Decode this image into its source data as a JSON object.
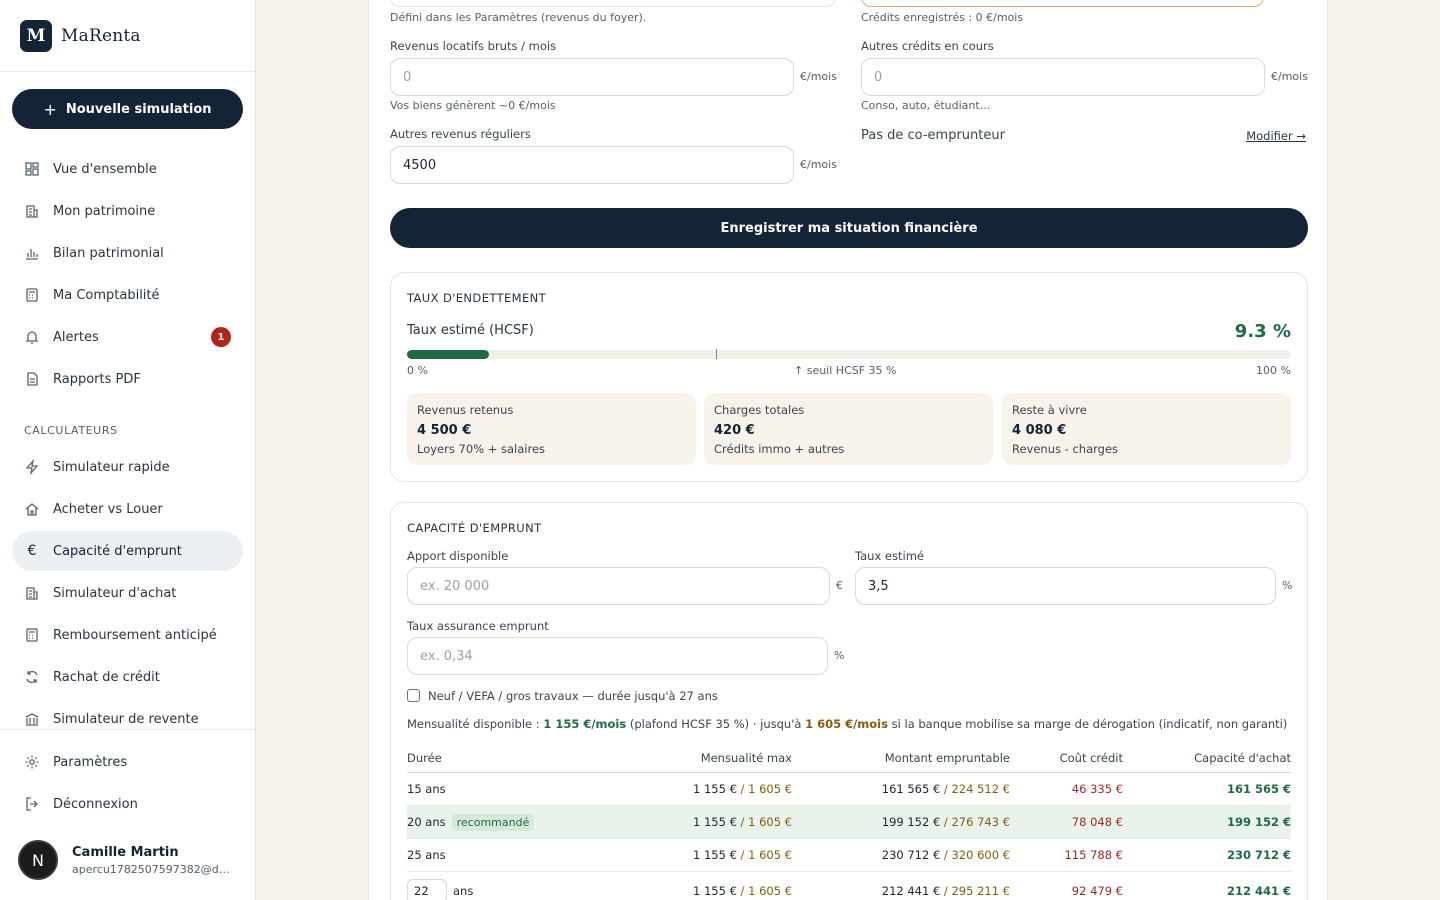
{
  "brand": {
    "logo_letter": "M",
    "name": "MaRenta"
  },
  "sidebar": {
    "new_simulation": "Nouvelle simulation",
    "main_items": [
      {
        "label": "Vue d'ensemble",
        "icon": "dashboard-icon"
      },
      {
        "label": "Mon patrimoine",
        "icon": "building-icon"
      },
      {
        "label": "Bilan patrimonial",
        "icon": "bar-chart-icon"
      },
      {
        "label": "Ma Comptabilité",
        "icon": "calculator-icon"
      },
      {
        "label": "Alertes",
        "icon": "bell-icon",
        "badge": "1"
      },
      {
        "label": "Rapports PDF",
        "icon": "document-icon"
      }
    ],
    "section_calculateurs": "CALCULATEURS",
    "calc_items": [
      {
        "label": "Simulateur rapide",
        "icon": "lightning-icon"
      },
      {
        "label": "Acheter vs Louer",
        "icon": "home-icon"
      },
      {
        "label": "Capacité d'emprunt",
        "icon": "euro-icon",
        "active": true
      },
      {
        "label": "Simulateur d'achat",
        "icon": "building-icon"
      },
      {
        "label": "Remboursement anticipé",
        "icon": "calculator-icon"
      },
      {
        "label": "Rachat de crédit",
        "icon": "refresh-icon"
      },
      {
        "label": "Simulateur de revente",
        "icon": "bank-icon"
      }
    ],
    "bottom_items": [
      {
        "label": "Paramètres",
        "icon": "gear-icon"
      },
      {
        "label": "Déconnexion",
        "icon": "logout-icon"
      }
    ],
    "user": {
      "initial": "N",
      "name": "Camille Martin",
      "email": "apercu1782507597382@de..."
    }
  },
  "finance_form": {
    "income_hint": "Défini dans les Paramètres (revenus du foyer).",
    "credits_hint": "Crédits enregistrés : 0 €/mois",
    "rental_income": {
      "label": "Revenus locatifs bruts / mois",
      "placeholder": "0",
      "unit": "€/mois",
      "hint": "Vos biens génèrent ~0 €/mois"
    },
    "other_credits": {
      "label": "Autres crédits en cours",
      "placeholder": "0",
      "unit": "€/mois",
      "hint": "Conso, auto, étudiant..."
    },
    "other_income": {
      "label": "Autres revenus réguliers",
      "value": "4500",
      "unit": "€/mois"
    },
    "co_borrower": {
      "text": "Pas de co-emprunteur",
      "link": "Modifier →"
    },
    "save_button": "Enregistrer ma situation financière"
  },
  "debt_ratio": {
    "title": "TAUX D'ENDETTEMENT",
    "label": "Taux estimé (HCSF)",
    "value_text": "9.3 %",
    "value": 9.3,
    "threshold": 35,
    "min_label": "0 %",
    "threshold_label": "↑ seuil HCSF 35 %",
    "max_label": "100 %",
    "stats": [
      {
        "label": "Revenus retenus",
        "value": "4 500 €",
        "sub": "Loyers 70% + salaires"
      },
      {
        "label": "Charges totales",
        "value": "420 €",
        "sub": "Crédits immo + autres"
      },
      {
        "label": "Reste à vivre",
        "value": "4 080 €",
        "sub": "Revenus - charges"
      }
    ]
  },
  "capacity": {
    "title": "CAPACITÉ D'EMPRUNT",
    "apport": {
      "label": "Apport disponible",
      "placeholder": "ex. 20 000",
      "unit": "€"
    },
    "rate": {
      "label": "Taux estimé",
      "value": "3,5",
      "unit": "%"
    },
    "insurance": {
      "label": "Taux assurance emprunt",
      "placeholder": "ex. 0,34",
      "unit": "%"
    },
    "checkbox_label": "Neuf / VEFA / gros travaux — durée jusqu'à 27 ans",
    "summary": {
      "prefix": "Mensualité disponible : ",
      "monthly": "1 155 €/mois",
      "mid": " (plafond HCSF 35 %) · jusqu'à ",
      "max_monthly": "1 605 €/mois",
      "suffix": " si la banque mobilise sa marge de dérogation (indicatif, non garanti)"
    },
    "table": {
      "headers": [
        "Durée",
        "Mensualité max",
        "Montant empruntable",
        "Coût crédit",
        "Capacité d'achat"
      ],
      "rows": [
        {
          "duration": "15 ans",
          "monthly": "1 155 €",
          "monthly_max": "1 605 €",
          "amount": "161 565 €",
          "amount_max": "224 512 €",
          "cost": "46 335 €",
          "capacity": "161 565 €"
        },
        {
          "duration": "20 ans",
          "tag": "recommandé",
          "monthly": "1 155 €",
          "monthly_max": "1 605 €",
          "amount": "199 152 €",
          "amount_max": "276 743 €",
          "cost": "78 048 €",
          "capacity": "199 152 €"
        },
        {
          "duration": "25 ans",
          "monthly": "1 155 €",
          "monthly_max": "1 605 €",
          "amount": "230 712 €",
          "amount_max": "320 600 €",
          "cost": "115 788 €",
          "capacity": "230 712 €"
        },
        {
          "duration_input": "22",
          "duration_unit": "ans",
          "monthly": "1 155 €",
          "monthly_max": "1 605 €",
          "amount": "212 441 €",
          "amount_max": "295 211 €",
          "cost": "92 479 €",
          "capacity": "212 441 €"
        }
      ]
    }
  },
  "colors": {
    "navy": "#152336",
    "green": "#1f6b44",
    "gold": "#8a5a0b",
    "red": "#b42318",
    "cream": "#f5f2ea"
  }
}
